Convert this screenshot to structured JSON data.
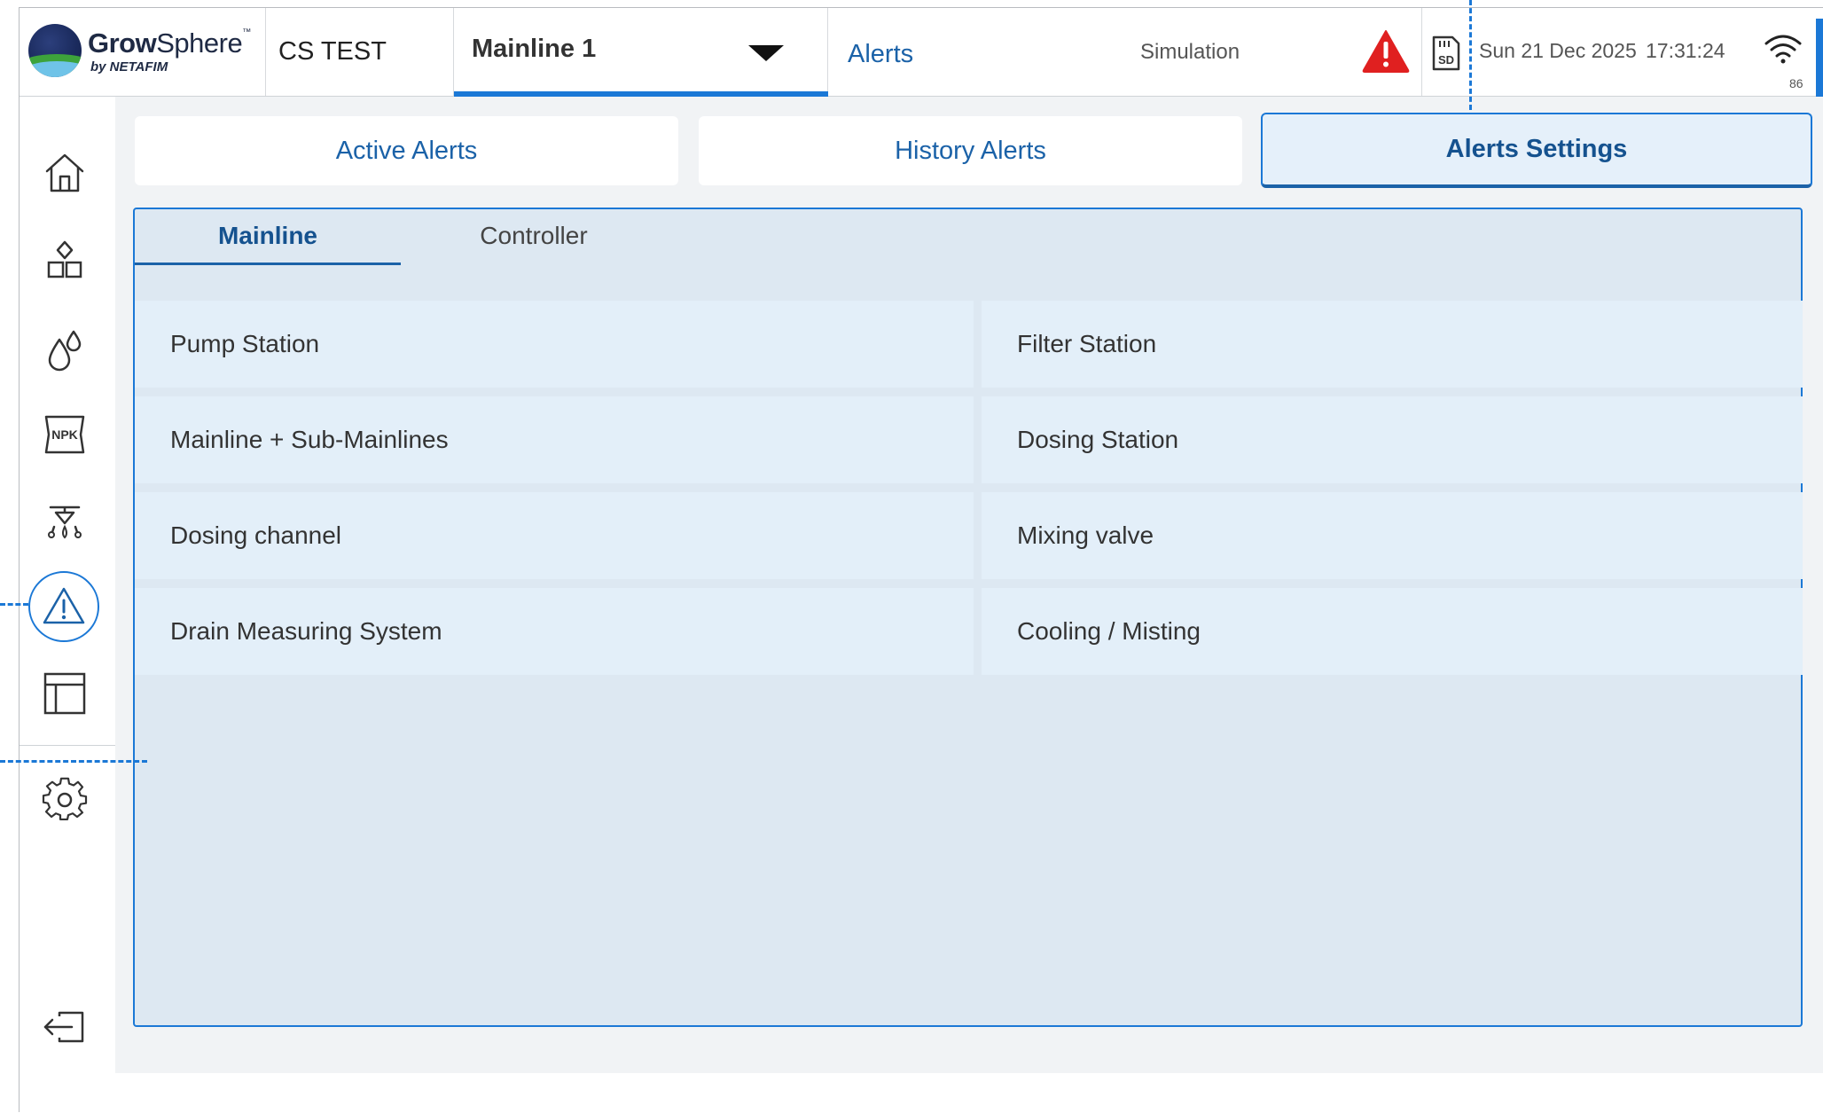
{
  "header": {
    "brand": {
      "name_bold": "Grow",
      "name_regular": "Sphere",
      "trademark": "™",
      "by_line": "by NETAFIM"
    },
    "site_name": "CS TEST",
    "mainline_selector": {
      "value": "Mainline 1",
      "icon": "chevron-down-icon"
    },
    "page_title": "Alerts",
    "mode_label": "Simulation",
    "alert_icon": "warning-triangle-icon",
    "alert_color": "#e02020",
    "sd_icon": "sd-card-icon",
    "date": "Sun 21 Dec 2025",
    "time": "17:31:24",
    "wifi": {
      "icon": "wifi-icon",
      "signal": "86"
    }
  },
  "sidebar": {
    "items": [
      {
        "name": "home",
        "icon": "home-icon"
      },
      {
        "name": "structure",
        "icon": "blocks-icon"
      },
      {
        "name": "irrigation",
        "icon": "water-drops-icon"
      },
      {
        "name": "fertigation",
        "icon": "npk-bag-icon"
      },
      {
        "name": "climate",
        "icon": "sprinkler-icon"
      },
      {
        "name": "alerts",
        "icon": "alert-triangle-icon",
        "active": true
      },
      {
        "name": "reports",
        "icon": "table-layout-icon"
      },
      {
        "name": "settings",
        "icon": "gear-icon"
      },
      {
        "name": "logout",
        "icon": "logout-icon"
      }
    ]
  },
  "tabs": [
    {
      "label": "Active Alerts",
      "selected": false
    },
    {
      "label": "History Alerts",
      "selected": false
    },
    {
      "label": "Alerts Settings",
      "selected": true
    }
  ],
  "subtabs": [
    {
      "label": "Mainline",
      "selected": true
    },
    {
      "label": "Controller",
      "selected": false
    }
  ],
  "settings_grid": [
    [
      "Pump Station",
      "Filter Station"
    ],
    [
      "Mainline + Sub-Mainlines",
      "Dosing Station"
    ],
    [
      "Dosing channel",
      "Mixing valve"
    ],
    [
      "Drain Measuring System",
      "Cooling / Misting"
    ]
  ],
  "colors": {
    "accent": "#1b78d6",
    "accent_dark": "#1b62a8",
    "panel_bg": "#dde8f2",
    "cell_bg": "#e3eff9",
    "main_bg": "#f1f3f5"
  }
}
